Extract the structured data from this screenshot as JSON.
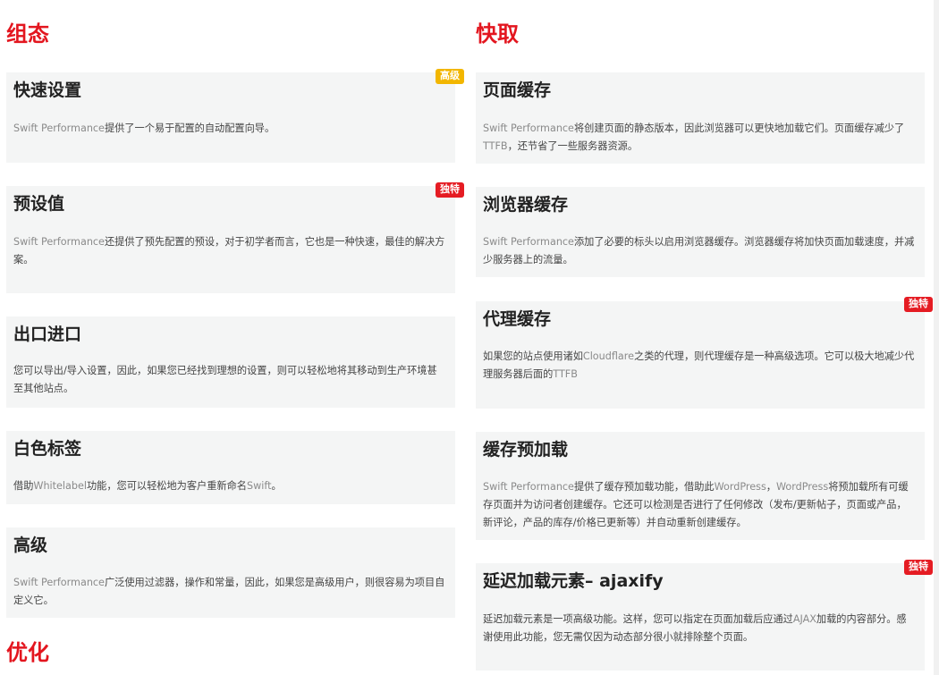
{
  "sections": {
    "left_title": "组态",
    "right_title": "快取",
    "bottom_left_title": "优化"
  },
  "colors": {
    "section_title": "#e3161f",
    "card_bg": "#f4f5f5",
    "badge_gold": "#f2b600",
    "badge_red": "#e51c23"
  },
  "left_cards": [
    {
      "title": "快速设置",
      "badge": "高级",
      "desc_brand": "Swift Performance",
      "desc_rest": "提供了一个易于配置的自动配置向导。"
    },
    {
      "title": "预设值",
      "badge": "独特",
      "desc_brand": "Swift Performance",
      "desc_rest": "还提供了预先配置的预设，对于初学者而言，它也是一种快速，最佳的解决方案。"
    },
    {
      "title": "出口进口",
      "desc": "您可以导出/导入设置，因此，如果您已经找到理想的设置，则可以轻松地将其移动到生产环境甚至其他站点。"
    },
    {
      "title": "白色标签",
      "desc_a": "借助",
      "desc_brand": "Whitelabel",
      "desc_b": "功能，您可以轻松地为客户重新命名",
      "desc_brand2": "Swift",
      "desc_c": "。"
    },
    {
      "title": "高级",
      "desc_brand": "Swift Performance",
      "desc_rest": "广泛使用过滤器，操作和常量，因此，如果您是高级用户，则很容易为项目自定义它。"
    }
  ],
  "right_cards": [
    {
      "title": "页面缓存",
      "desc_brand": "Swift Performance",
      "desc_a": "将创建页面的静态版本，因此浏览器可以更快地加载它们。页面缓存减少了",
      "desc_brand2": "TTFB",
      "desc_b": "，还节省了一些服务器资源。"
    },
    {
      "title": "浏览器缓存",
      "desc_brand": "Swift Performance",
      "desc_rest": "添加了必要的标头以启用浏览器缓存。浏览器缓存将加快页面加载速度，并减少服务器上的流量。"
    },
    {
      "title": "代理缓存",
      "badge": "独特",
      "desc_a": "如果您的站点使用诸如",
      "desc_brand": "Cloudflare",
      "desc_b": "之类的代理，则代理缓存是一种高级选项。它可以极大地减少代理服务器后面的",
      "desc_brand2": "TTFB"
    },
    {
      "title": "缓存预加载",
      "desc_brand": "Swift Performance",
      "desc_a": "提供了缓存预加载功能，借助此",
      "desc_brand2": "WordPress",
      "desc_b": "，",
      "desc_brand3": "WordPress",
      "desc_c": "将预加载所有可缓存页面并为访问者创建缓存。它还可以检测是否进行了任何修改（发布/更新帖子，页面或产品，新评论，产品的库存/价格已更新等）并自动重新创建缓存。"
    },
    {
      "title": "延迟加载元素– ajaxify",
      "badge": "独特",
      "desc_a": "延迟加载元素是一项高级功能。这样，您可以指定在页面加载后应通过",
      "desc_brand": "AJAX",
      "desc_b": "加载的内容部分。感谢使用此功能，您无需仅因为动态部分很小就排除整个页面。"
    }
  ]
}
